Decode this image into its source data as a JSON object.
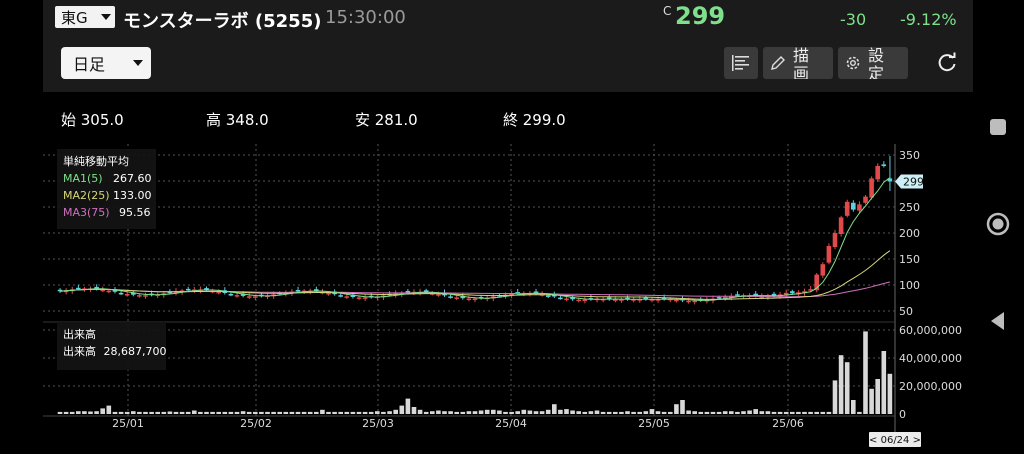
{
  "header": {
    "market": "東G",
    "stock_name": "モンスターラボ (5255)",
    "time": "15:30:00",
    "c_mark": "C",
    "price": "299",
    "change": "-30",
    "change_pct": "-9.12%",
    "price_color": "#7ee08a"
  },
  "toolbar": {
    "period": "日足",
    "draw_label": "描画",
    "settings_label": "設定"
  },
  "ohlc": {
    "open": "始 305.0",
    "high": "高 348.0",
    "low": "安 281.0",
    "close": "終 299.0"
  },
  "price_legend": {
    "title": "単純移動平均",
    "ma1_label": "MA1(5)",
    "ma1_value": "267.60",
    "ma1_color": "#7ee08a",
    "ma2_label": "MA2(25)",
    "ma2_value": "133.00",
    "ma2_color": "#d6d67a",
    "ma3_label": "MA3(75)",
    "ma3_value": "95.56",
    "ma3_color": "#d070c0"
  },
  "volume_legend": {
    "title": "出来高",
    "label": "出来高",
    "value": "28,687,700"
  },
  "price_axis": {
    "ticks": [
      "350",
      "300",
      "250",
      "200",
      "150",
      "100",
      "50"
    ],
    "current": "299"
  },
  "volume_axis": {
    "ticks": [
      "60,000,000",
      "40,000,000",
      "20,000,000",
      "0"
    ]
  },
  "x_axis": {
    "ticks": [
      "25/01",
      "25/02",
      "25/03",
      "25/04",
      "25/05",
      "25/06"
    ],
    "cursor_label": "< 06/24 >"
  },
  "colors": {
    "up": "#e04a4a",
    "down": "#5ad0e0",
    "grid": "#555555"
  },
  "chart_data": [
    {
      "type": "candlestick",
      "title": "",
      "ylim": [
        40,
        360
      ],
      "series": [
        {
          "name": "MA1(5)",
          "last": 267.6
        },
        {
          "name": "MA2(25)",
          "last": 133.0
        },
        {
          "name": "MA3(75)",
          "last": 95.56
        }
      ],
      "last_candle": {
        "open": 305.0,
        "high": 348.0,
        "low": 281.0,
        "close": 299.0
      }
    },
    {
      "type": "bar",
      "title": "",
      "ylabel": "出来高",
      "ylim": [
        0,
        60000000
      ],
      "values": [
        1500000,
        1500000,
        1500000,
        2000000,
        2000000,
        1800000,
        2000000,
        4000000,
        6000000,
        1500000,
        1500000,
        1500000,
        2000000,
        1500000,
        1500000,
        1500000,
        1500000,
        1500000,
        1800000,
        1500000,
        1500000,
        1500000,
        2500000,
        1500000,
        1500000,
        1500000,
        1500000,
        1500000,
        1500000,
        1500000,
        2000000,
        1500000,
        1500000,
        1500000,
        1500000,
        1500000,
        1500000,
        1500000,
        1500000,
        1500000,
        1500000,
        1500000,
        1500000,
        3000000,
        1500000,
        1500000,
        1500000,
        1500000,
        1500000,
        1500000,
        1500000,
        1500000,
        2000000,
        1500000,
        2000000,
        3000000,
        6000000,
        11000000,
        5000000,
        3000000,
        1500000,
        2000000,
        2500000,
        2000000,
        2000000,
        1500000,
        1500000,
        2000000,
        2000000,
        2500000,
        3000000,
        3000000,
        2500000,
        1500000,
        1500000,
        2000000,
        3000000,
        2500000,
        2000000,
        2000000,
        3000000,
        7000000,
        3000000,
        3500000,
        2500000,
        2000000,
        1500000,
        2000000,
        2500000,
        1500000,
        1500000,
        1500000,
        1500000,
        2000000,
        1500000,
        1500000,
        2000000,
        3500000,
        2000000,
        1500000,
        1500000,
        7000000,
        10000000,
        2500000,
        2000000,
        1500000,
        1500000,
        1500000,
        1500000,
        2000000,
        2000000,
        1500000,
        2000000,
        2500000,
        3500000,
        2000000,
        2000000,
        1500000,
        1500000,
        1500000,
        1500000,
        1500000,
        1500000,
        1500000,
        1500000,
        1500000,
        1500000,
        24000000,
        42000000,
        37000000,
        10000000,
        1500000,
        59000000,
        18000000,
        25000000,
        45000000,
        28687700
      ]
    }
  ]
}
